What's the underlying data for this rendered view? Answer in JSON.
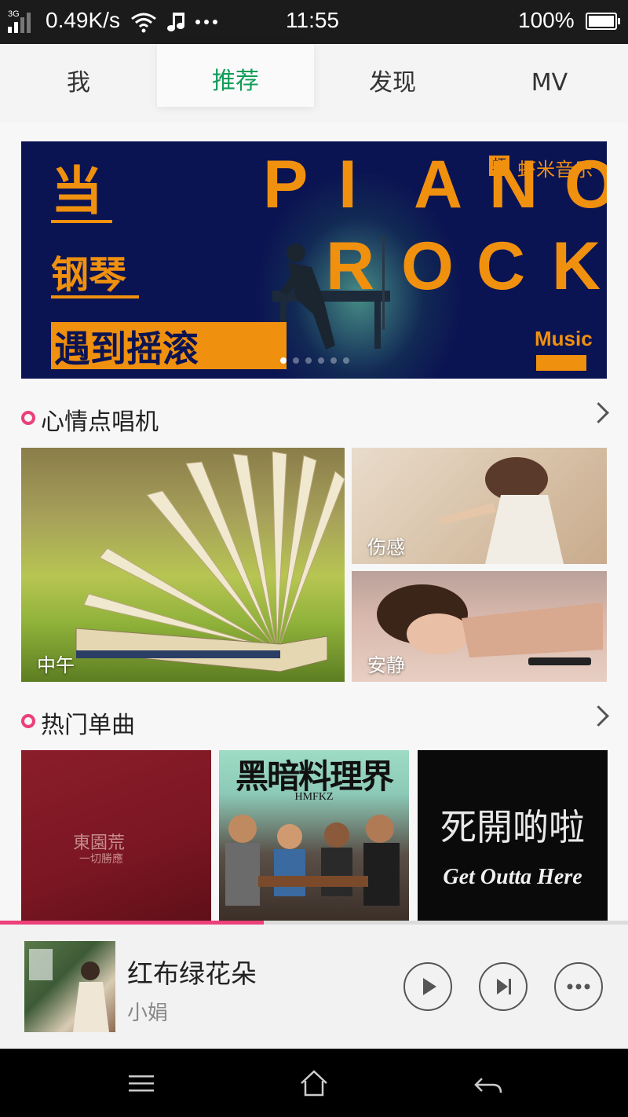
{
  "status_bar": {
    "network": "3G",
    "speed": "0.49K/s",
    "time": "11:55",
    "battery": "100%"
  },
  "tabs": [
    {
      "label": "我"
    },
    {
      "label": "推荐"
    },
    {
      "label": "发现"
    },
    {
      "label": "MV"
    }
  ],
  "active_tab": "推荐",
  "banner": {
    "headline_1": "当",
    "headline_2": "钢琴",
    "headline_3": "遇到摇滚",
    "word_1": "PIANO",
    "word_2": "ROCK",
    "brand_icon": "虾",
    "brand": "虾米音乐",
    "music_tag": "Music",
    "page_count": 6,
    "active_page": 1
  },
  "mood_section": {
    "title": "心情点唱机",
    "tiles": [
      {
        "label": "中午"
      },
      {
        "label": "伤感"
      },
      {
        "label": "安静"
      }
    ]
  },
  "hot_section": {
    "title": "热门单曲",
    "covers": [
      {
        "title": "東園荒",
        "subtitle": "一切勝應"
      },
      {
        "title": "黑暗料理界",
        "subtitle": "HMFKZ"
      },
      {
        "title": "死開啲啦",
        "subtitle": "Get Outta Here"
      }
    ]
  },
  "player": {
    "song": "红布绿花朵",
    "artist": "小娟",
    "progress": 0.42
  },
  "colors": {
    "accent_green": "#0f9d58",
    "accent_pink": "#ec407a",
    "banner_bg": "#0b1452",
    "banner_orange": "#f0900f"
  }
}
